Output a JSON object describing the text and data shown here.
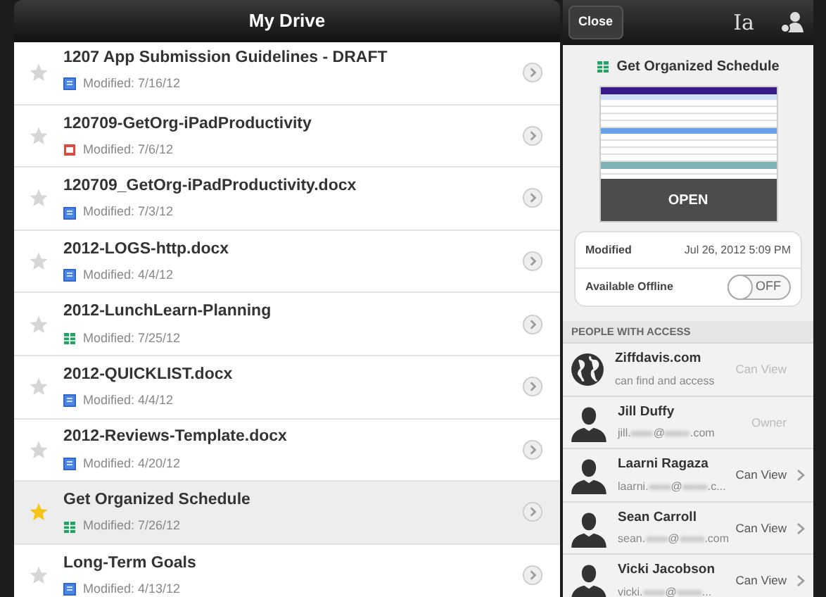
{
  "list_title": "My Drive",
  "files": [
    {
      "name": "1207 App Submission Guidelines - DRAFT",
      "modified": "Modified: 7/16/12",
      "kind": "doc",
      "starred": false,
      "selected": false
    },
    {
      "name": "120709-GetOrg-iPadProductivity",
      "modified": "Modified: 7/6/12",
      "kind": "slides",
      "starred": false,
      "selected": false
    },
    {
      "name": "120709_GetOrg-iPadProductivity.docx",
      "modified": "Modified: 7/3/12",
      "kind": "doc",
      "starred": false,
      "selected": false
    },
    {
      "name": "2012-LOGS-http.docx",
      "modified": "Modified: 4/4/12",
      "kind": "doc",
      "starred": false,
      "selected": false
    },
    {
      "name": "2012-LunchLearn-Planning",
      "modified": "Modified: 7/25/12",
      "kind": "sheet",
      "starred": false,
      "selected": false
    },
    {
      "name": "2012-QUICKLIST.docx",
      "modified": "Modified: 4/4/12",
      "kind": "doc",
      "starred": false,
      "selected": false
    },
    {
      "name": "2012-Reviews-Template.docx",
      "modified": "Modified: 4/20/12",
      "kind": "doc",
      "starred": false,
      "selected": false
    },
    {
      "name": "Get Organized Schedule",
      "modified": "Modified: 7/26/12",
      "kind": "sheet",
      "starred": true,
      "selected": true
    },
    {
      "name": "Long-Term Goals",
      "modified": "Modified: 4/13/12",
      "kind": "doc",
      "starred": false,
      "selected": false
    }
  ],
  "details": {
    "close": "Close",
    "format_icon": "Ia",
    "title": "Get Organized Schedule",
    "kind": "sheet",
    "open": "OPEN",
    "modified_label": "Modified",
    "modified_value": "Jul 26, 2012 5:09 PM",
    "offline_label": "Available Offline",
    "offline": {
      "on": false,
      "label": "OFF"
    },
    "access_heading": "PEOPLE WITH ACCESS",
    "people": [
      {
        "kind": "domain",
        "name": "Ziffdavis.com",
        "sub": "can find and access",
        "role": "Can View",
        "editable": false
      },
      {
        "kind": "person",
        "name": "Jill Duffy",
        "email": [
          "jill.",
          "@",
          ".com"
        ],
        "role": "Owner",
        "editable": false
      },
      {
        "kind": "person",
        "name": "Laarni Ragaza",
        "email": [
          "laarni.",
          "@",
          ".c..."
        ],
        "role": "Can View",
        "editable": true
      },
      {
        "kind": "person",
        "name": "Sean Carroll",
        "email": [
          "sean.",
          "@",
          ".com"
        ],
        "role": "Can View",
        "editable": true
      },
      {
        "kind": "person",
        "name": "Vicki Jacobson",
        "email": [
          "vicki.",
          "@",
          "..."
        ],
        "role": "Can View",
        "editable": true
      }
    ]
  }
}
